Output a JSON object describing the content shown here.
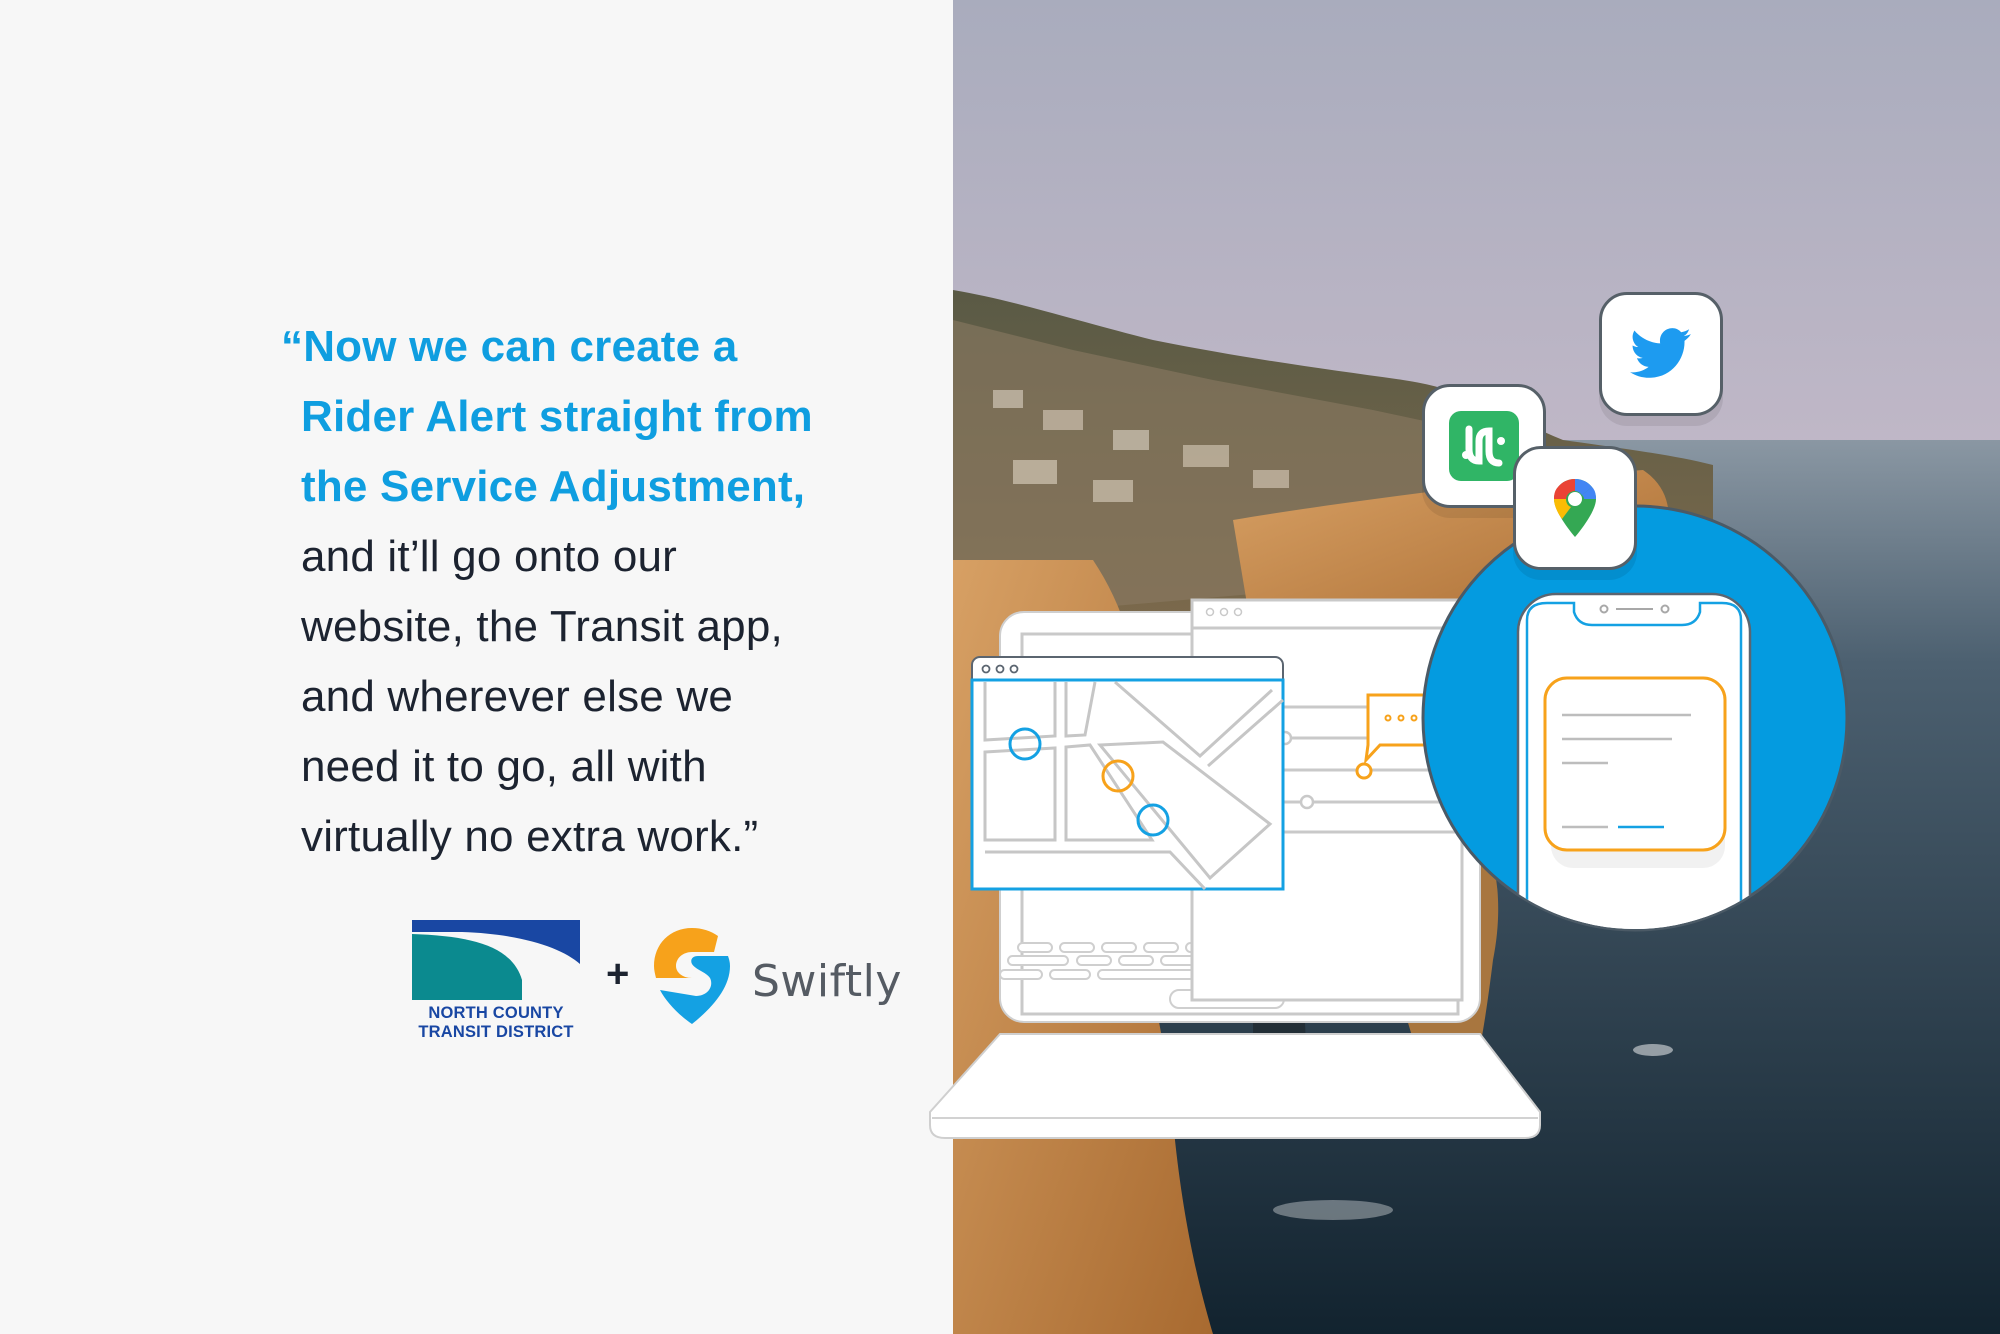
{
  "quote": {
    "highlight_lines": [
      "“Now we can create a",
      "Rider Alert straight from",
      "the Service Adjustment,"
    ],
    "body_lines": [
      "and it’ll go onto our",
      "website, the Transit app,",
      "and wherever else we",
      "need it to go, all with",
      "virtually no extra work.”"
    ]
  },
  "logos": {
    "partner_name_line1": "NORTH COUNTY",
    "partner_name_line2": "TRANSIT DISTRICT",
    "plus_sign": "+",
    "brand_name": "Swiftly"
  },
  "illustration": {
    "app_icons": [
      "twitter-icon",
      "transit-app-icon",
      "google-maps-icon"
    ],
    "devices": [
      "laptop",
      "map-browser-window",
      "alert-browser-window",
      "smartphone"
    ],
    "chat_bubble_text": "•••"
  },
  "colors": {
    "accent_blue": "#0f9ee0",
    "circle_blue": "#049be0",
    "orange": "#f7a21b",
    "text_dark": "#1c2330",
    "background": "#f7f7f7",
    "nctd_blue": "#1947a3",
    "nctd_teal": "#0b8a8f",
    "twitter_blue": "#1d9bf0",
    "transit_green": "#30b566"
  }
}
